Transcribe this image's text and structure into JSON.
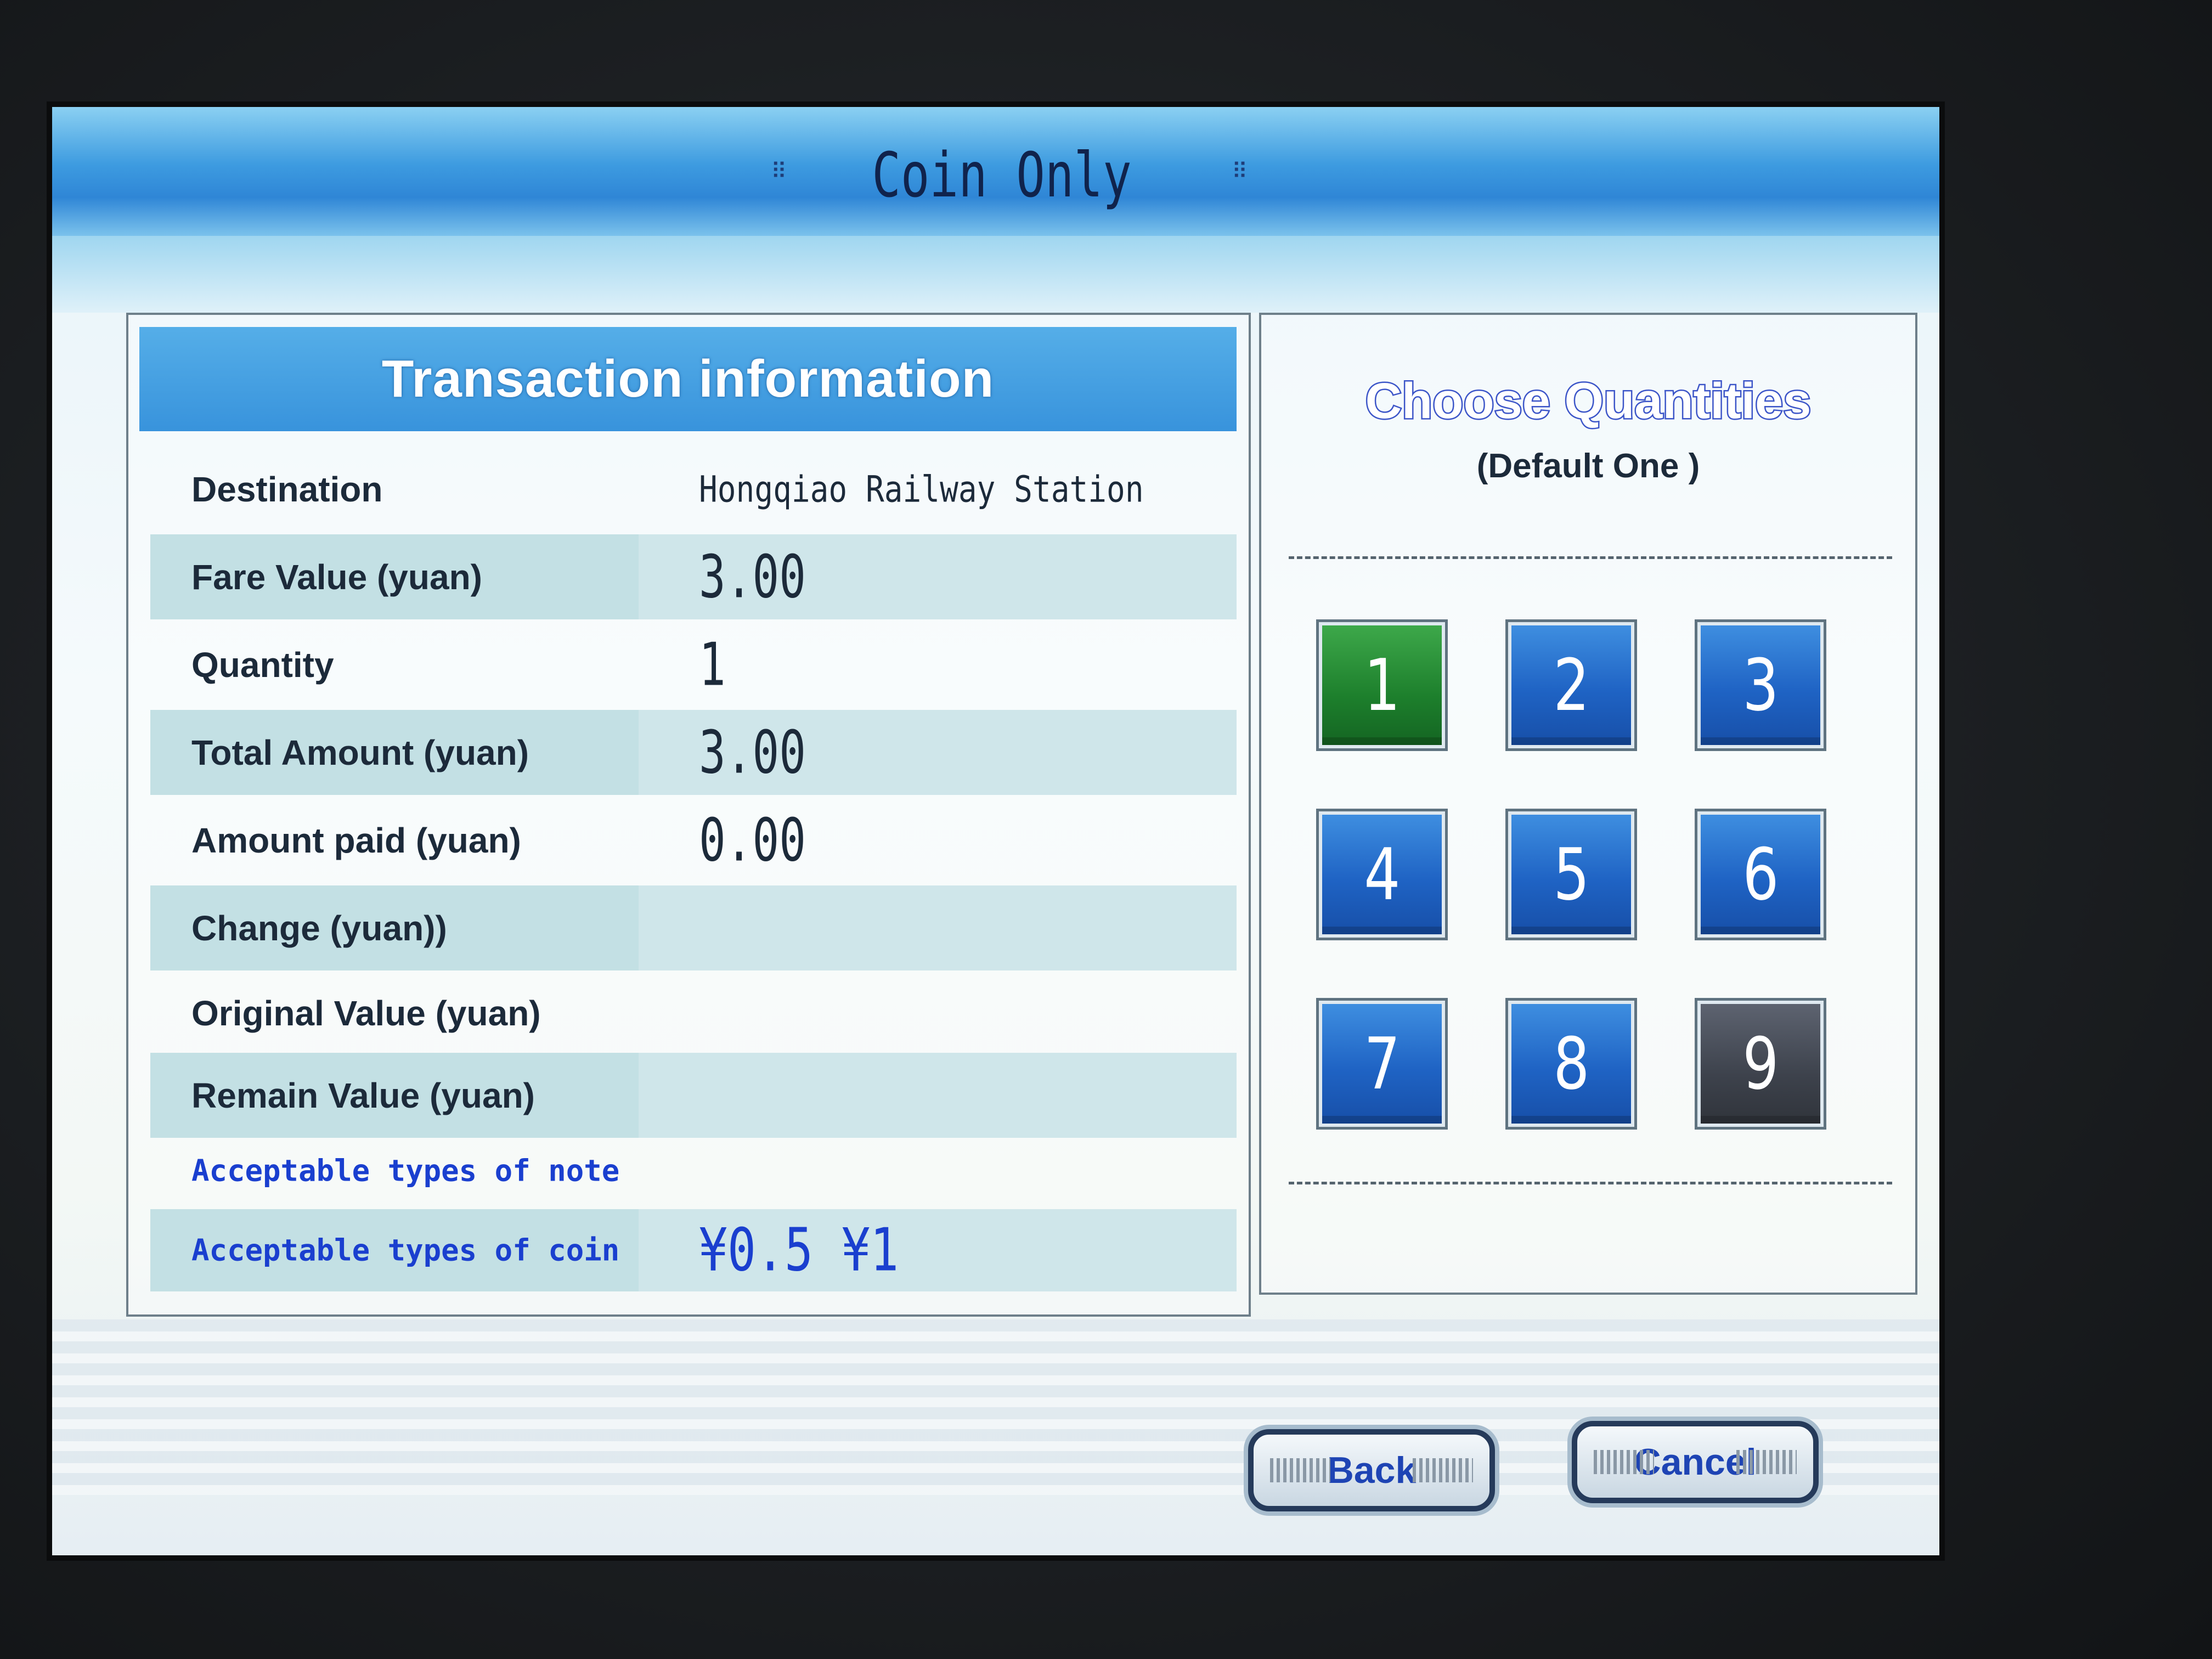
{
  "header": {
    "title": "Coin Only"
  },
  "transaction": {
    "title": "Transaction information",
    "rows": [
      {
        "label": "Destination",
        "value": "Hongqiao Railway Station"
      },
      {
        "label": "Fare Value (yuan)",
        "value": "3.00"
      },
      {
        "label": "Quantity",
        "value": "1"
      },
      {
        "label": "Total Amount (yuan)",
        "value": "3.00"
      },
      {
        "label": "Amount paid (yuan)",
        "value": "0.00"
      },
      {
        "label": "Change (yuan))",
        "value": ""
      },
      {
        "label": "Original Value (yuan)",
        "value": ""
      },
      {
        "label": "Remain Value (yuan)",
        "value": ""
      },
      {
        "label": "Acceptable types of note",
        "value": ""
      },
      {
        "label": "Acceptable types of coin",
        "value": "¥0.5 ¥1"
      }
    ]
  },
  "quantities": {
    "title": "Choose Quantities",
    "subtitle": "(Default One )",
    "selected": "1",
    "disabled": "9",
    "buttons": [
      "1",
      "2",
      "3",
      "4",
      "5",
      "6",
      "7",
      "8",
      "9"
    ]
  },
  "footer": {
    "back_label": "Back",
    "cancel_label": "Cancel"
  },
  "colors": {
    "accent": "#3893dc",
    "selected": "#1d7f2c",
    "disabled": "#3d424c",
    "link_text": "#1a3fcf"
  }
}
